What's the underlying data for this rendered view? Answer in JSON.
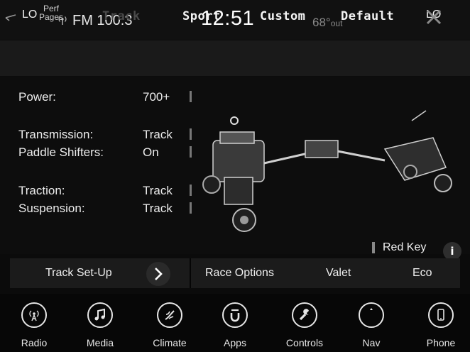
{
  "status": {
    "left_label": "LO",
    "radio_station": "FM 100.3",
    "clock": "12:51",
    "temperature": "68°",
    "temperature_suffix": "out",
    "right_label": "LO"
  },
  "mode_tabs": {
    "perf_pages_line1": "Perf",
    "perf_pages_line2": "Pages",
    "items": [
      "Track",
      "Sport",
      "Custom",
      "Default"
    ],
    "active": "Track"
  },
  "settings": [
    {
      "label": "Power:",
      "value": "700+"
    },
    {
      "label": "Transmission:",
      "value": "Track"
    },
    {
      "label": "Paddle Shifters:",
      "value": "On"
    },
    {
      "label": "Traction:",
      "value": "Track"
    },
    {
      "label": "Suspension:",
      "value": "Track"
    }
  ],
  "key_status": "Red Key",
  "info_label": "i",
  "options": {
    "track_setup": "Track Set-Up",
    "race_options": "Race Options",
    "valet": "Valet",
    "eco": "Eco"
  },
  "nav": [
    {
      "label": "Radio",
      "icon": "radio-icon"
    },
    {
      "label": "Media",
      "icon": "music-note-icon"
    },
    {
      "label": "Climate",
      "icon": "climate-icon"
    },
    {
      "label": "Apps",
      "icon": "apps-u-icon"
    },
    {
      "label": "Controls",
      "icon": "wrench-icon"
    },
    {
      "label": "Nav",
      "icon": "compass-icon"
    },
    {
      "label": "Phone",
      "icon": "phone-icon"
    }
  ]
}
